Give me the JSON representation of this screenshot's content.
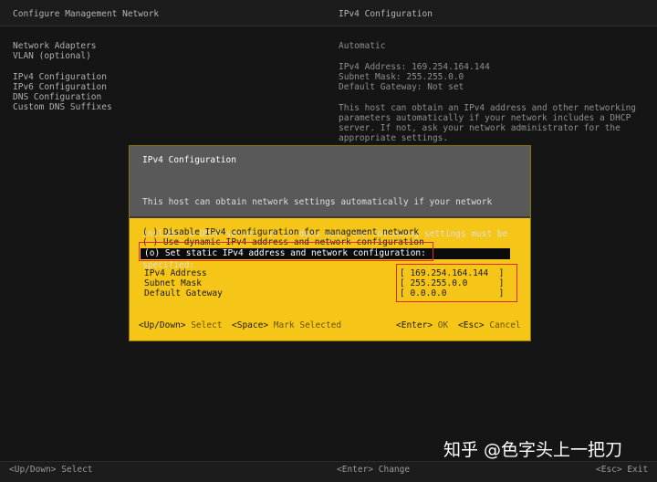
{
  "header": {
    "left_title": "Configure Management Network",
    "right_title": "IPv4 Configuration"
  },
  "menu": {
    "items": [
      "Network Adapters",
      "VLAN (optional)",
      "IPv4 Configuration",
      "IPv6 Configuration",
      "DNS Configuration",
      "Custom DNS Suffixes"
    ]
  },
  "info_pane": {
    "mode": "Automatic",
    "ipv4_address": "IPv4 Address: 169.254.164.144",
    "subnet_mask": "Subnet Mask: 255.255.0.0",
    "default_gateway": "Default Gateway: Not set",
    "description_lines": [
      "This host can obtain an IPv4 address and other networking",
      "parameters automatically if your network includes a DHCP",
      "server. If not, ask your network administrator for the",
      "appropriate settings."
    ]
  },
  "dialog": {
    "title": "IPv4 Configuration",
    "description_lines": [
      "This host can obtain network settings automatically if your network",
      "includes a DHCP server. If it does not, the following settings must be",
      "specified:"
    ],
    "options": {
      "disable": "( ) Disable IPv4 configuration for management network",
      "dhcp": "( ) Use dynamic IPv4 address and network configuration",
      "static": "(o) Set static IPv4 address and network configuration:"
    },
    "fields": {
      "ipv4_label": "IPv4 Address",
      "ipv4_value": "[ 169.254.164.144  ]",
      "subnet_label": "Subnet Mask",
      "subnet_value": "[ 255.255.0.0      ]",
      "gateway_label": "Default Gateway",
      "gateway_value": "[ 0.0.0.0          ]"
    },
    "hints": {
      "updown_key": "<Up/Down>",
      "updown_action": " Select",
      "space_key": "<Space>",
      "space_action": " Mark Selected",
      "enter_key": "<Enter>",
      "enter_action": " OK",
      "esc_key": "<Esc>",
      "esc_action": " Cancel"
    },
    "colors": {
      "body": "#f5c518",
      "header": "#595959",
      "annotation": "#e0282e"
    }
  },
  "footer": {
    "select": "<Up/Down> Select",
    "change": "<Enter> Change",
    "exit": "<Esc> Exit"
  },
  "watermark": {
    "text": "知乎 @色字头上一把刀"
  }
}
